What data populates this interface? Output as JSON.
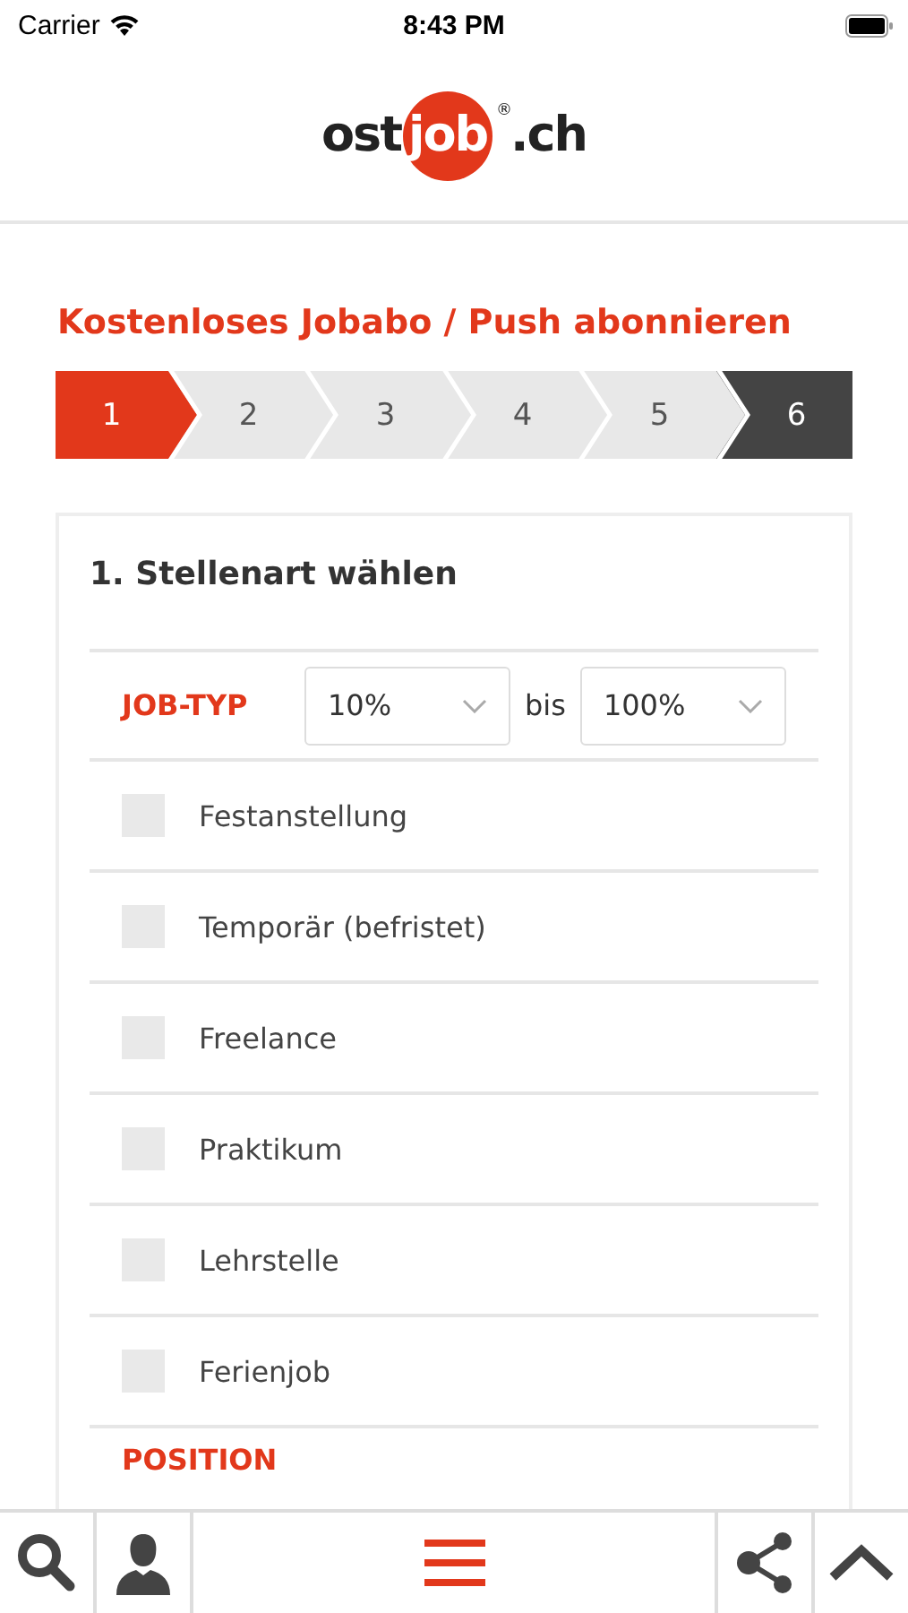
{
  "status_bar": {
    "carrier": "Carrier",
    "time": "8:43 PM"
  },
  "logo": {
    "prefix": "ost",
    "highlight": "job",
    "mark": "®",
    "suffix": ".ch"
  },
  "title": "Kostenloses Jobabo / Push abonnieren",
  "steps": [
    {
      "label": "1",
      "kind": "current"
    },
    {
      "label": "2",
      "kind": "pending"
    },
    {
      "label": "3",
      "kind": "pending"
    },
    {
      "label": "4",
      "kind": "pending"
    },
    {
      "label": "5",
      "kind": "pending"
    },
    {
      "label": "6",
      "kind": "final"
    }
  ],
  "card": {
    "heading": "1. Stellenart wählen",
    "job_type": {
      "label": "JOB-TYP",
      "from": "10%",
      "separator": "bis",
      "to": "100%"
    },
    "options": [
      {
        "label": "Festanstellung",
        "checked": false
      },
      {
        "label": "Temporär (befristet)",
        "checked": false
      },
      {
        "label": "Freelance",
        "checked": false
      },
      {
        "label": "Praktikum",
        "checked": false
      },
      {
        "label": "Lehrstelle",
        "checked": false
      },
      {
        "label": "Ferienjob",
        "checked": false
      }
    ],
    "next_section": "POSITION"
  }
}
